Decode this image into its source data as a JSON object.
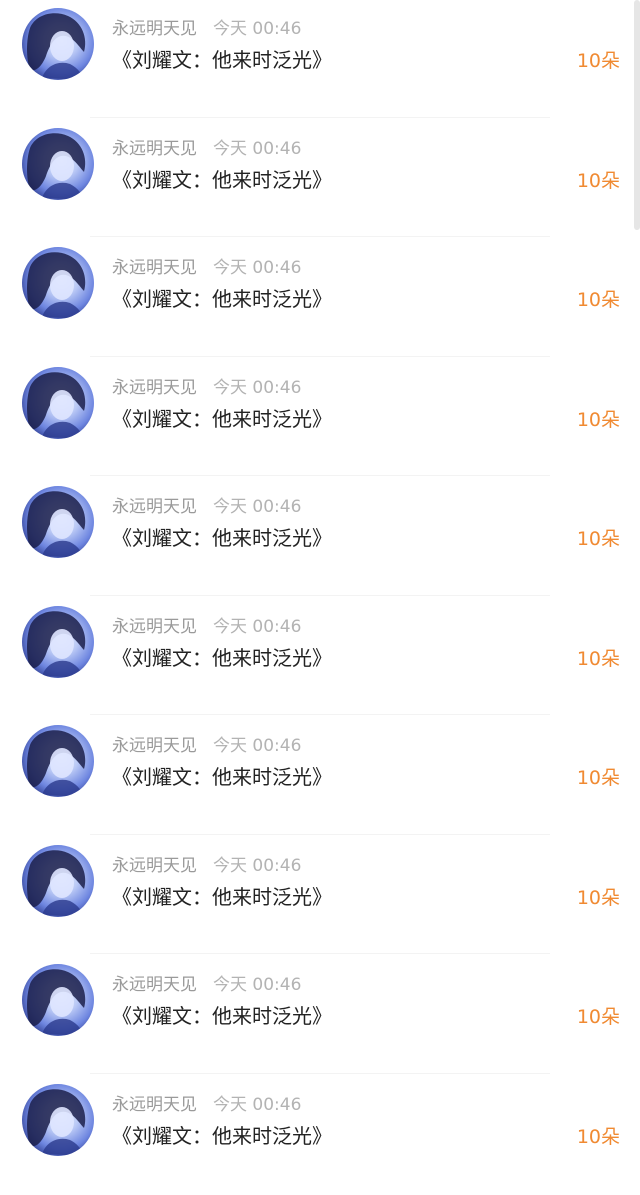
{
  "list": [
    {
      "username": "永远明天见",
      "time": "今天 00:46",
      "title": "《刘耀文：他来时泛光》",
      "amount": "10朵"
    },
    {
      "username": "永远明天见",
      "time": "今天 00:46",
      "title": "《刘耀文：他来时泛光》",
      "amount": "10朵"
    },
    {
      "username": "永远明天见",
      "time": "今天 00:46",
      "title": "《刘耀文：他来时泛光》",
      "amount": "10朵"
    },
    {
      "username": "永远明天见",
      "time": "今天 00:46",
      "title": "《刘耀文：他来时泛光》",
      "amount": "10朵"
    },
    {
      "username": "永远明天见",
      "time": "今天 00:46",
      "title": "《刘耀文：他来时泛光》",
      "amount": "10朵"
    },
    {
      "username": "永远明天见",
      "time": "今天 00:46",
      "title": "《刘耀文：他来时泛光》",
      "amount": "10朵"
    },
    {
      "username": "永远明天见",
      "time": "今天 00:46",
      "title": "《刘耀文：他来时泛光》",
      "amount": "10朵"
    },
    {
      "username": "永远明天见",
      "time": "今天 00:46",
      "title": "《刘耀文：他来时泛光》",
      "amount": "10朵"
    },
    {
      "username": "永远明天见",
      "time": "今天 00:46",
      "title": "《刘耀文：他来时泛光》",
      "amount": "10朵"
    },
    {
      "username": "永远明天见",
      "time": "今天 00:46",
      "title": "《刘耀文：他来时泛光》",
      "amount": "10朵"
    }
  ],
  "colors": {
    "accent": "#f08a32",
    "title": "#222222",
    "meta": "#9a9a9a"
  },
  "icons": {
    "avatar": "user-avatar-photo"
  }
}
